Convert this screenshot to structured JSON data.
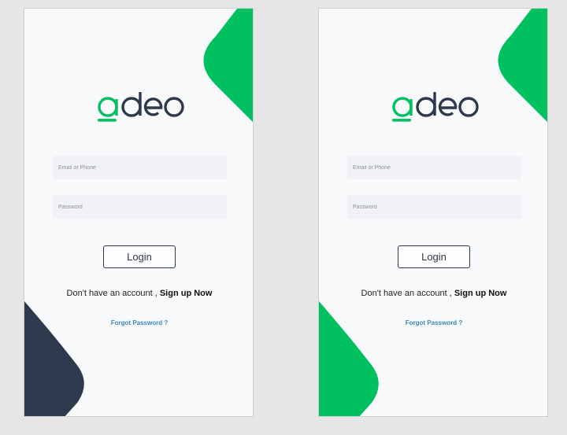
{
  "screens": [
    {
      "id": "screen-1",
      "logo_text": "adeo",
      "email_placeholder": "Email or Phone",
      "password_placeholder": "Password",
      "login_label": "Login",
      "signup_prompt": "Don't have an account ,",
      "signup_link": "Sign up Now",
      "forgot_link": "Forgot Password ?",
      "top_shape_color": "#00c060",
      "bottom_shape_color": "#2d3a4d"
    },
    {
      "id": "screen-2",
      "logo_text": "adeo",
      "email_placeholder": "Email or Phone",
      "password_placeholder": "Password",
      "login_label": "Login",
      "signup_prompt": "Don't have an account ,",
      "signup_link": "Sign up Now",
      "forgot_link": "Forgot Password ?",
      "top_shape_color": "#00c060",
      "bottom_shape_color": "#00c060"
    }
  ],
  "colors": {
    "brand_green": "#00c060",
    "brand_navy": "#2d3a4d",
    "link_blue": "#3b86b8"
  }
}
